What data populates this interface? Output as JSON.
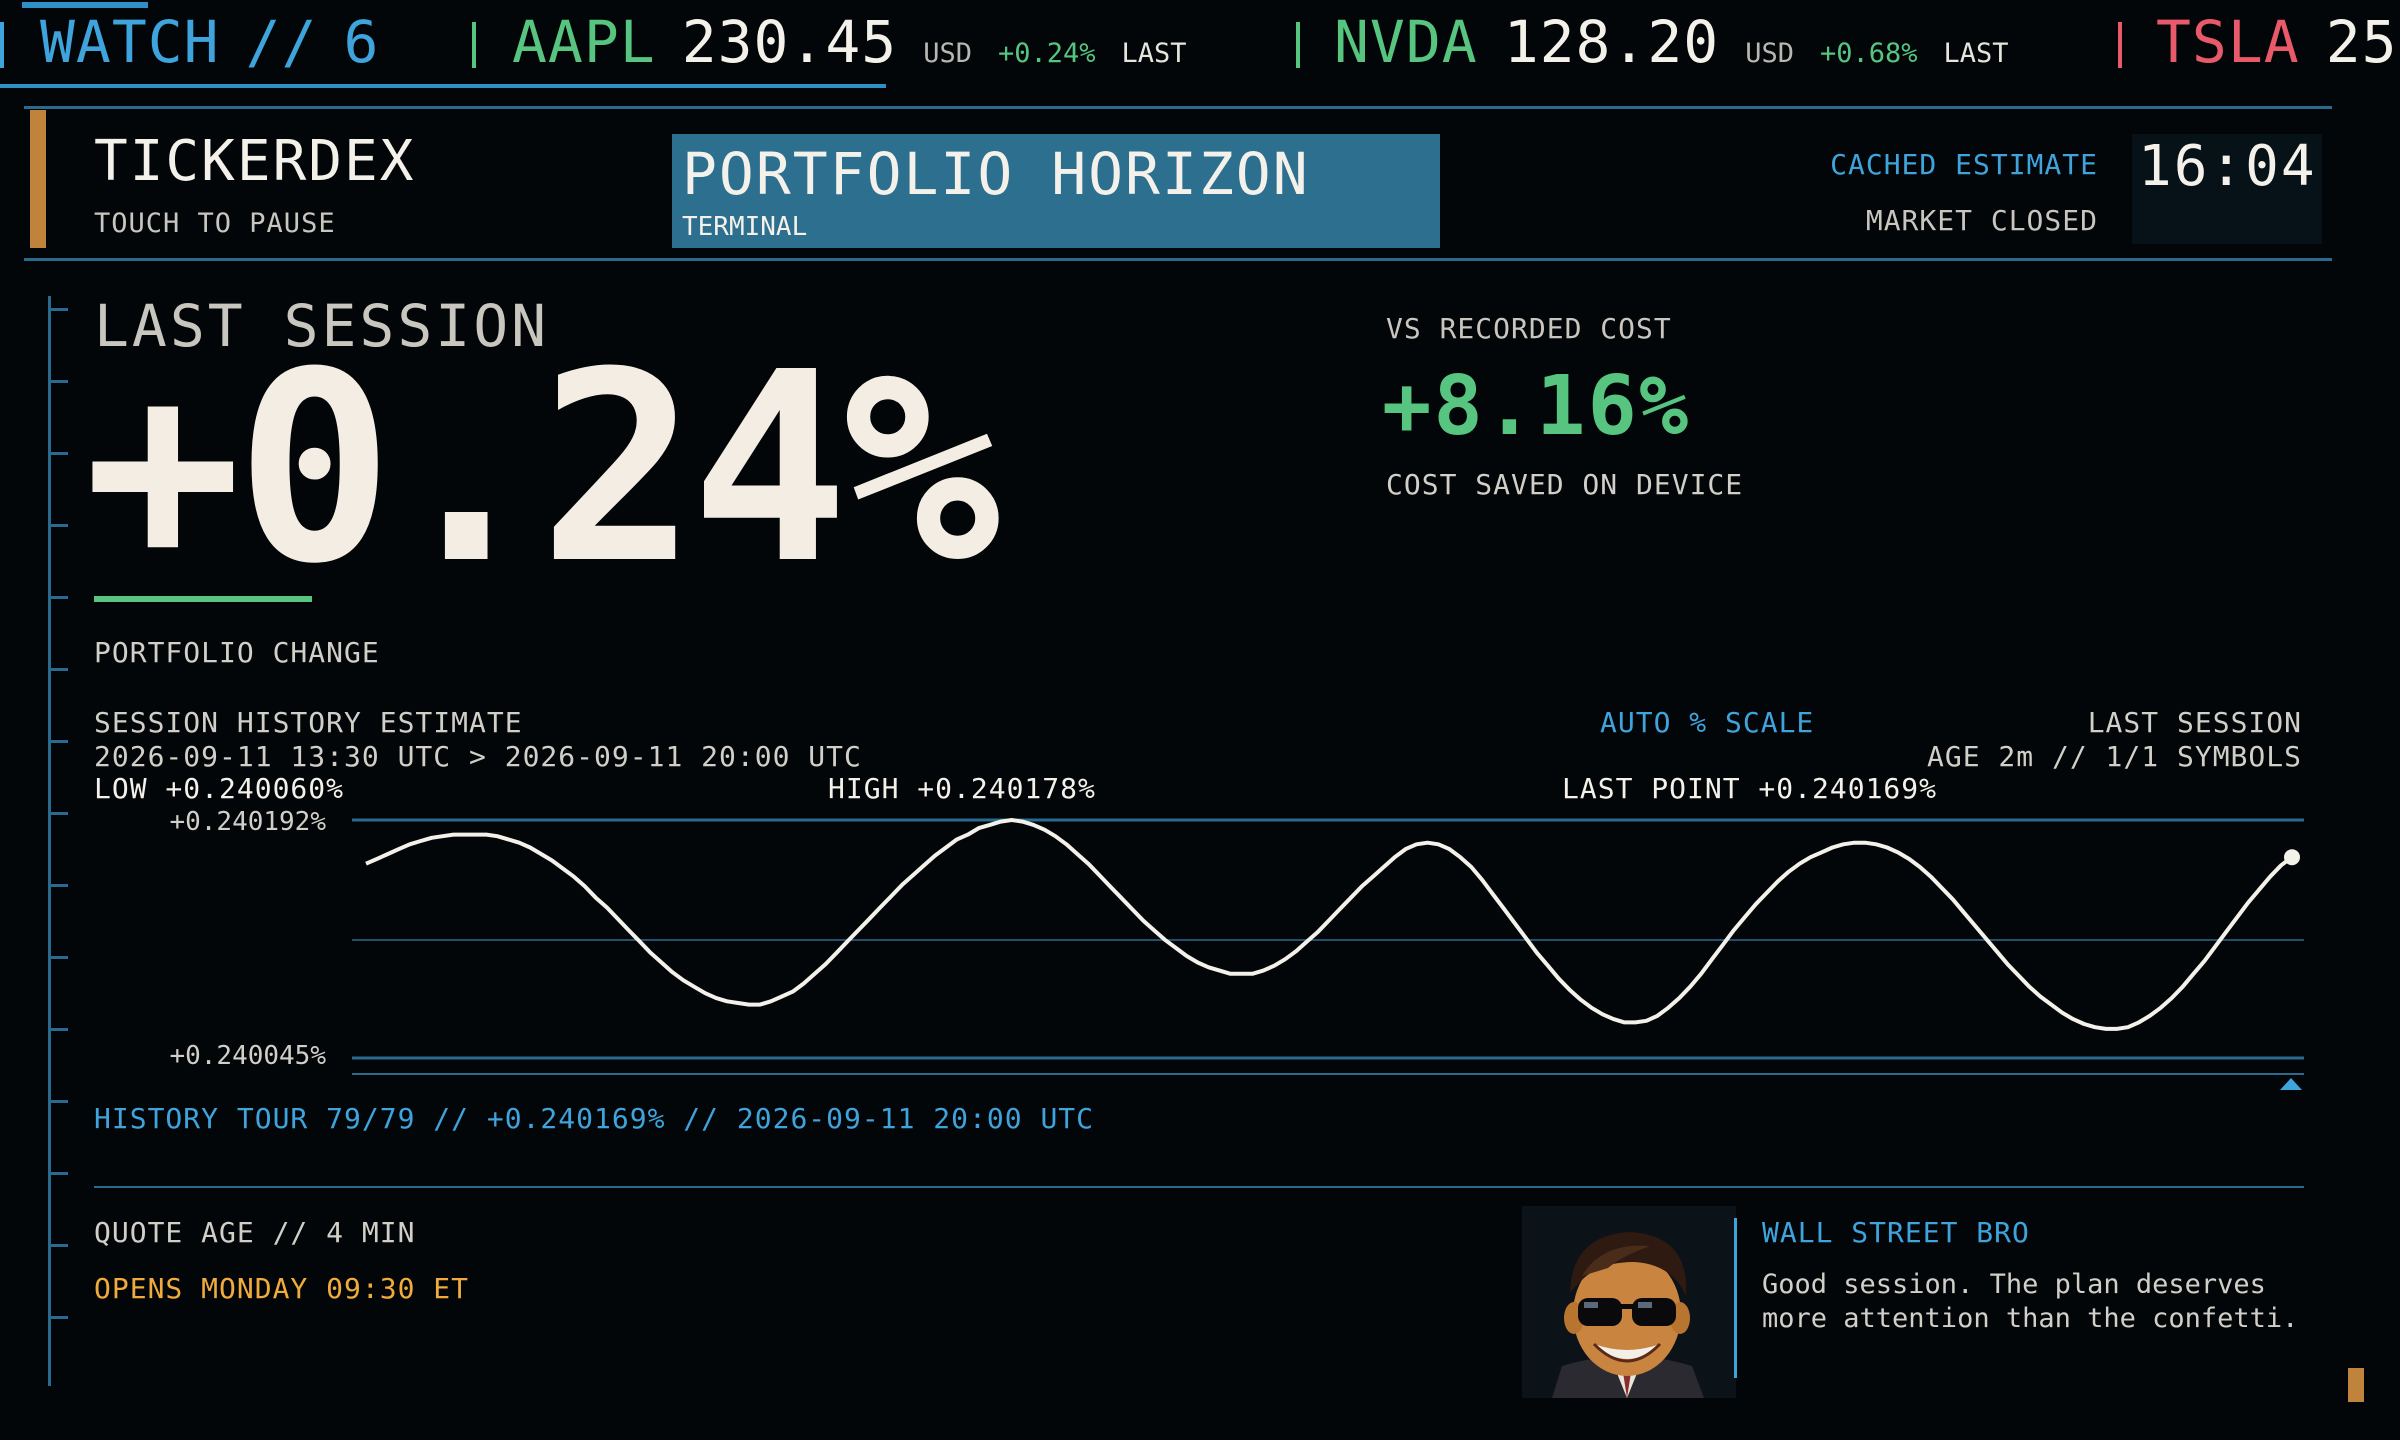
{
  "ticker": {
    "watch_label": "WATCH",
    "watch_sep": "//",
    "watch_count": "6",
    "items": [
      {
        "symbol": "AAPL",
        "price": "230.45",
        "currency": "USD",
        "change": "+0.24%",
        "status": "LAST",
        "color": "#57c47f"
      },
      {
        "symbol": "NVDA",
        "price": "128.20",
        "currency": "USD",
        "change": "+0.68%",
        "status": "LAST",
        "color": "#57c47f"
      },
      {
        "symbol": "TSLA",
        "price": "25",
        "currency": "",
        "change": "",
        "status": "",
        "color": "#e8596a"
      }
    ]
  },
  "header": {
    "brand": "TICKERDEX",
    "brand_sub": "TOUCH TO PAUSE",
    "title": "PORTFOLIO HORIZON",
    "title_sub": "TERMINAL",
    "estimate_label": "CACHED ESTIMATE",
    "market_status": "MARKET CLOSED",
    "clock": "16:04"
  },
  "hero": {
    "label": "LAST SESSION",
    "value": "+0.24%",
    "caption": "PORTFOLIO CHANGE",
    "cost_label": "VS RECORDED COST",
    "cost_value": "+8.16%",
    "cost_caption": "COST SAVED ON DEVICE"
  },
  "history": {
    "title": "SESSION HISTORY ESTIMATE",
    "range": "2026-09-11 13:30 UTC > 2026-09-11 20:00 UTC",
    "scale_mode": "AUTO % SCALE",
    "session_label": "LAST SESSION",
    "age_text": "AGE 2m // 1/1 SYMBOLS",
    "low_text": "LOW +0.240060%",
    "high_text": "HIGH +0.240178%",
    "last_text": "LAST POINT +0.240169%",
    "tour_text": "HISTORY TOUR 79/79 // +0.240169% // 2026-09-11 20:00 UTC"
  },
  "chart_data": {
    "type": "line",
    "title": "SESSION HISTORY ESTIMATE",
    "ylim": [
      0.240045,
      0.240192
    ],
    "ytick_labels": [
      "+0.240192%",
      "+0.240045%"
    ],
    "grid": true,
    "series": [
      {
        "values": [
          0.240165,
          0.240168,
          0.240171,
          0.240174,
          0.240177,
          0.240179,
          0.240181,
          0.240182,
          0.240183,
          0.240183,
          0.240183,
          0.240183,
          0.240182,
          0.24018,
          0.240178,
          0.240175,
          0.240171,
          0.240167,
          0.240162,
          0.240157,
          0.240151,
          0.240144,
          0.240138,
          0.240131,
          0.240124,
          0.240117,
          0.24011,
          0.240104,
          0.240098,
          0.240093,
          0.240089,
          0.240085,
          0.240082,
          0.24008,
          0.240079,
          0.240078,
          0.240078,
          0.24008,
          0.240083,
          0.240086,
          0.240091,
          0.240097,
          0.240103,
          0.24011,
          0.240117,
          0.240124,
          0.240131,
          0.240138,
          0.240145,
          0.240152,
          0.240158,
          0.240164,
          0.24017,
          0.240175,
          0.24018,
          0.240183,
          0.240187,
          0.240189,
          0.240191,
          0.240192,
          0.240191,
          0.240189,
          0.240186,
          0.240182,
          0.240177,
          0.240171,
          0.240165,
          0.240158,
          0.240151,
          0.240144,
          0.240137,
          0.24013,
          0.240124,
          0.240118,
          0.240113,
          0.240108,
          0.240104,
          0.240101,
          0.240099,
          0.240097,
          0.240097,
          0.240097,
          0.240099,
          0.240102,
          0.240106,
          0.240111,
          0.240117,
          0.240123,
          0.24013,
          0.240137,
          0.240144,
          0.240151,
          0.240157,
          0.240163,
          0.240169,
          0.240174,
          0.240177,
          0.240178,
          0.240177,
          0.240174,
          0.240169,
          0.240163,
          0.240155,
          0.240146,
          0.240137,
          0.240128,
          0.240119,
          0.24011,
          0.240102,
          0.240094,
          0.240087,
          0.240081,
          0.240076,
          0.240072,
          0.240069,
          0.240067,
          0.240067,
          0.240068,
          0.240071,
          0.240076,
          0.240082,
          0.240089,
          0.240097,
          0.240106,
          0.240115,
          0.240124,
          0.240132,
          0.24014,
          0.240147,
          0.240154,
          0.24016,
          0.240165,
          0.240169,
          0.240172,
          0.240175,
          0.240177,
          0.240178,
          0.240178,
          0.240177,
          0.240175,
          0.240172,
          0.240168,
          0.240163,
          0.240157,
          0.24015,
          0.240143,
          0.240135,
          0.240127,
          0.240119,
          0.240111,
          0.240103,
          0.240096,
          0.240089,
          0.240083,
          0.240078,
          0.240073,
          0.240069,
          0.240066,
          0.240064,
          0.240063,
          0.240063,
          0.240064,
          0.240067,
          0.240071,
          0.240076,
          0.240082,
          0.240089,
          0.240097,
          0.240105,
          0.240114,
          0.240123,
          0.240132,
          0.240141,
          0.240149,
          0.240157,
          0.240164,
          0.240169
        ]
      }
    ]
  },
  "footer": {
    "quote_age": "QUOTE AGE // 4 MIN",
    "opens": "OPENS MONDAY 09:30 ET"
  },
  "bro": {
    "name": "WALL STREET BRO",
    "message": "Good session. The plan deserves more attention than the confetti."
  },
  "colors": {
    "accent_blue": "#3fa3dc",
    "accent_green": "#57c47f",
    "accent_red": "#e8596a",
    "accent_amber": "#f0ab3c",
    "title_panel": "#2d6f8f"
  }
}
